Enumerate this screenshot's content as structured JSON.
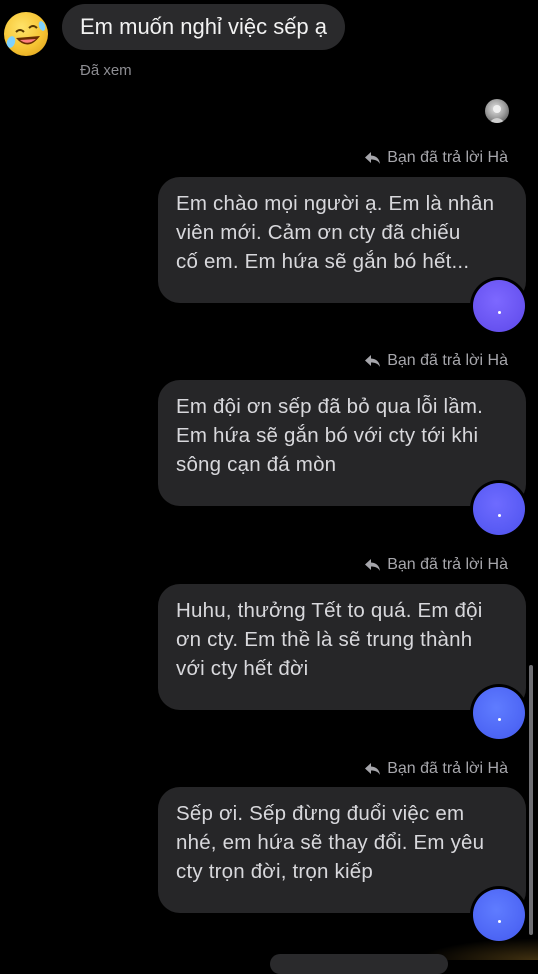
{
  "received": {
    "avatar_icon": "rofl-emoji-avatar",
    "text": "Em muốn nghỉ việc sếp ạ",
    "seen_label": "Đã xem"
  },
  "seen_avatar_icon": "small-profile-avatar",
  "messages": [
    {
      "reply_label": "Bạn đã trả lời Hà",
      "lines": [
        "Em chào mọi người ạ. Em là nhân",
        "viên mới. Cảm ơn cty đã chiếu",
        "cố em. Em hứa sẽ gắn bó hết..."
      ],
      "reaction_color": "#6a55f2"
    },
    {
      "reply_label": "Bạn đã trả lời Hà",
      "lines": [
        "Em đội ơn sếp đã bỏ qua lỗi lầm.",
        "Em hứa sẽ gắn bó với cty tới khi",
        "sông cạn đá mòn"
      ],
      "reaction_color": "#5a5cf5"
    },
    {
      "reply_label": "Bạn đã trả lời Hà",
      "lines": [
        "Huhu, thưởng Tết to quá. Em đội",
        "ơn cty. Em thề là sẽ trung thành",
        "với cty hết đời"
      ],
      "reaction_color": "#4f68f6"
    },
    {
      "reply_label": "Bạn đã trả lời Hà",
      "lines": [
        "Sếp ơi. Sếp đừng đuổi việc em",
        "nhé, em hứa sẽ thay đổi. Em yêu",
        "cty trọn đời, trọn kiếp"
      ],
      "reaction_color": "#4f68f6"
    }
  ],
  "colors": {
    "background": "#000000",
    "bubble": "#262628",
    "text": "#d8d8dc",
    "meta_text": "#a6a6ab"
  }
}
